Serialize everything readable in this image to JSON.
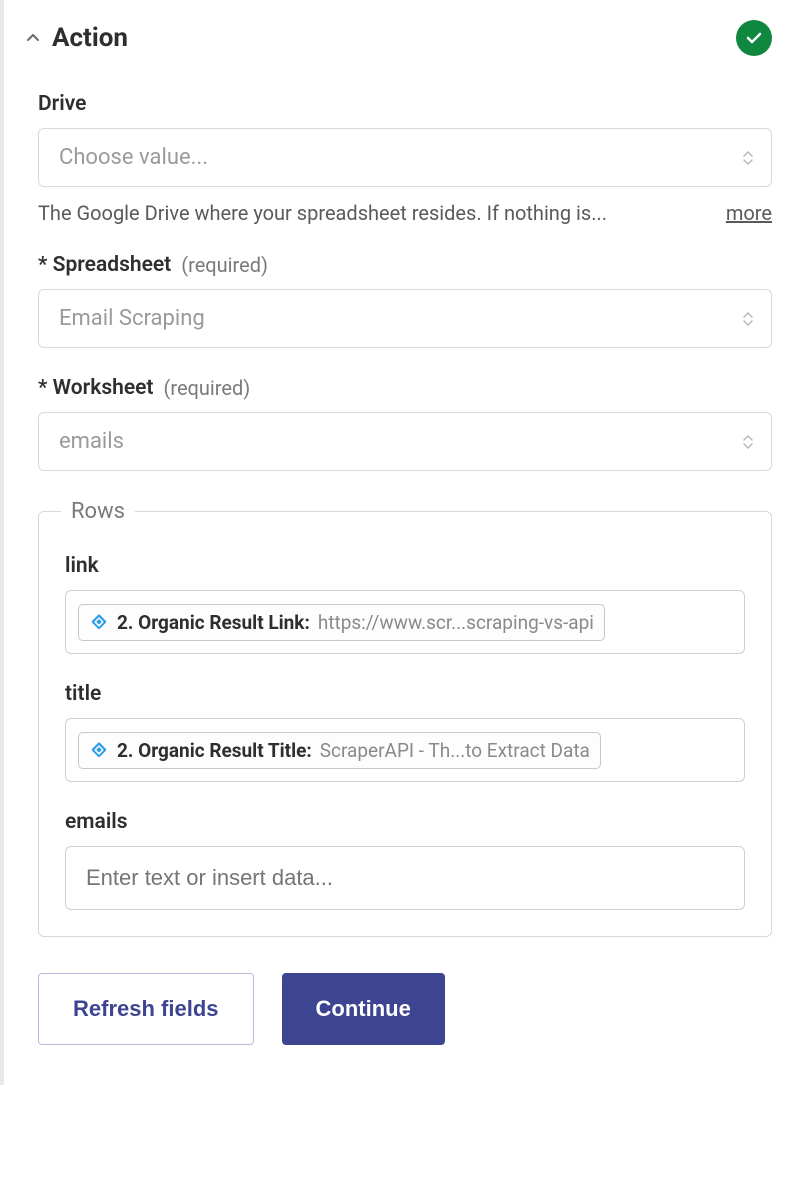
{
  "section": {
    "title": "Action"
  },
  "fields": {
    "drive": {
      "label": "Drive",
      "placeholder": "Choose value...",
      "helper": "The Google Drive where your spreadsheet resides. If nothing is...",
      "more": "more"
    },
    "spreadsheet": {
      "asterisk": "*",
      "label": "Spreadsheet",
      "required": "(required)",
      "value": "Email Scraping"
    },
    "worksheet": {
      "asterisk": "*",
      "label": "Worksheet",
      "required": "(required)",
      "value": "emails"
    }
  },
  "rows": {
    "legend": "Rows",
    "link": {
      "label": "link",
      "pill_label": "2. Organic Result Link:",
      "pill_value": "https://www.scr...scraping-vs-api"
    },
    "title": {
      "label": "title",
      "pill_label": "2. Organic Result Title:",
      "pill_value": "ScraperAPI - Th...to Extract Data"
    },
    "emails": {
      "label": "emails",
      "placeholder": "Enter text or insert data..."
    }
  },
  "buttons": {
    "refresh": "Refresh fields",
    "continue": "Continue"
  }
}
